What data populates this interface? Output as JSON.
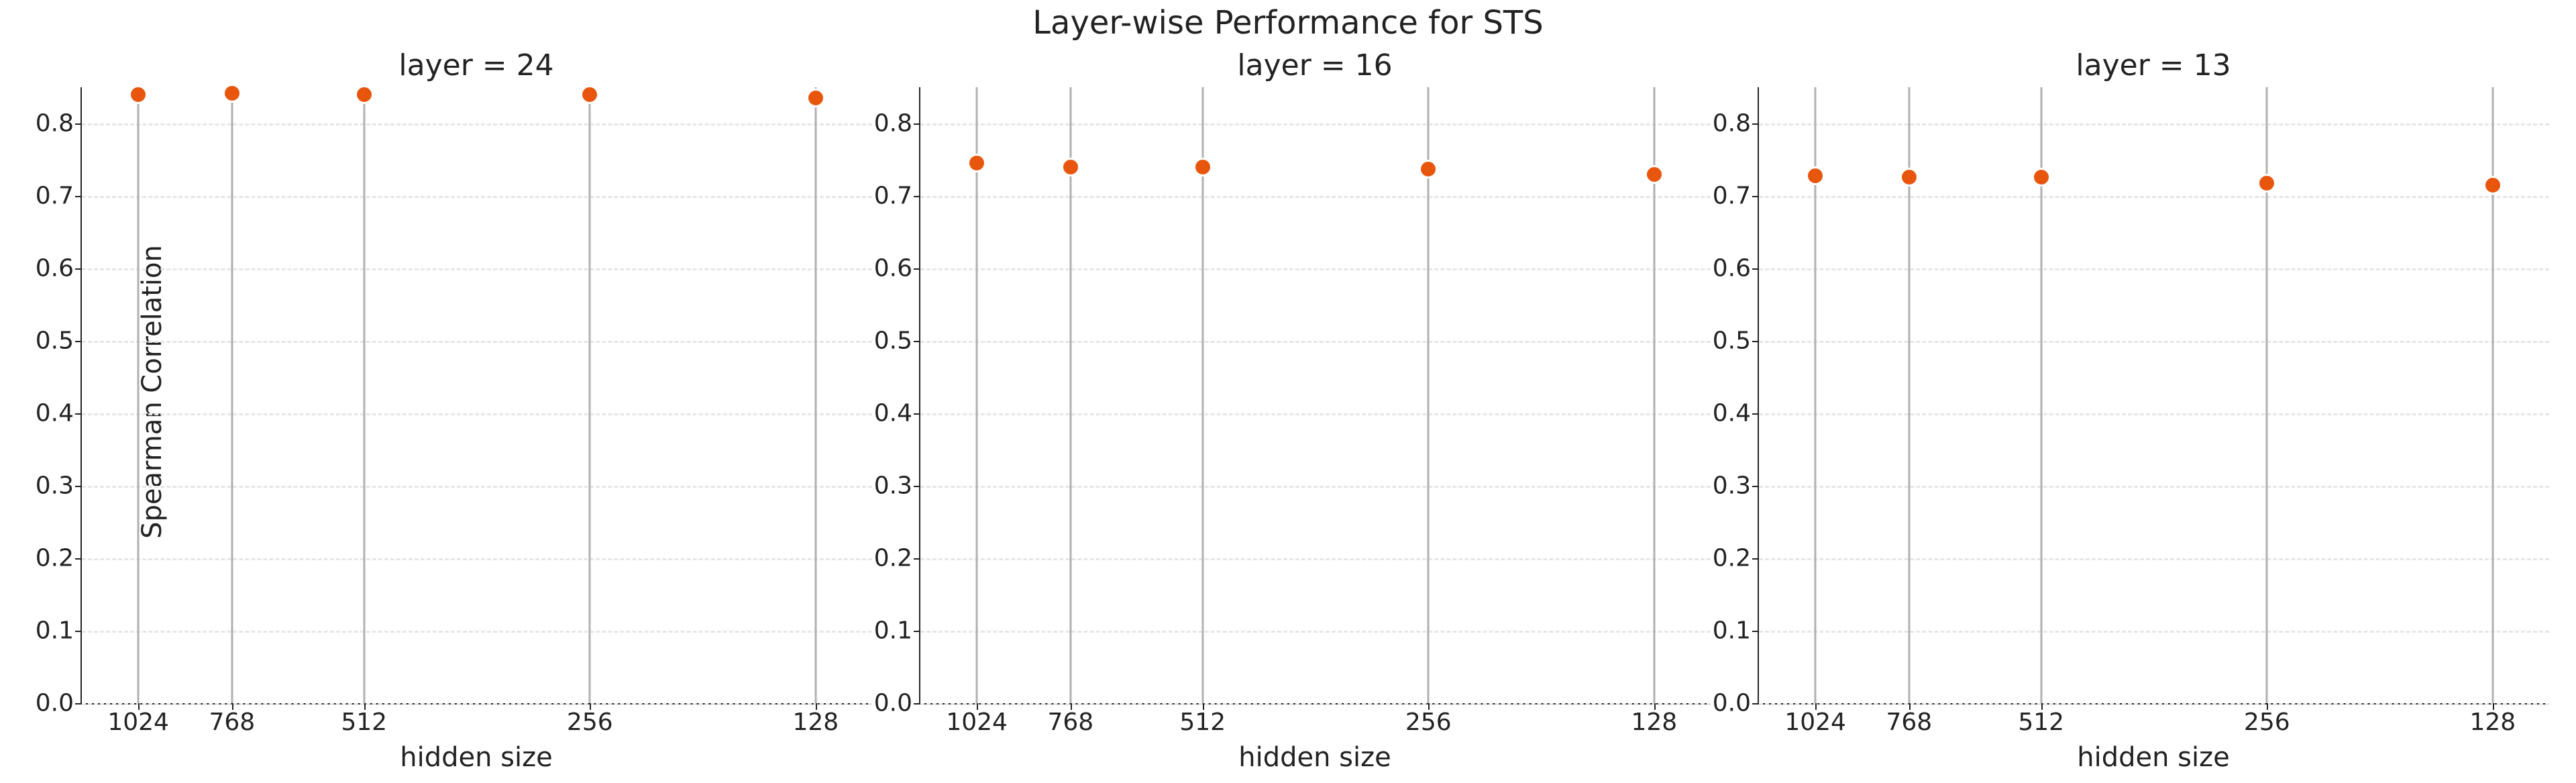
{
  "suptitle": "Layer-wise Performance for STS",
  "ylabel": "Spearman Correlation",
  "xlabel": "hidden size",
  "yticks": [
    0.0,
    0.1,
    0.2,
    0.3,
    0.4,
    0.5,
    0.6,
    0.7,
    0.8
  ],
  "ylim": [
    0.0,
    0.85
  ],
  "xcats": [
    "1024",
    "768",
    "512",
    "256",
    "128"
  ],
  "xpos_log": [
    10.0,
    9.585,
    9.0,
    8.0,
    7.0
  ],
  "xlim_log": [
    10.25,
    6.75
  ],
  "panels": [
    {
      "title": "layer = 24",
      "values": [
        0.84,
        0.842,
        0.84,
        0.84,
        0.835
      ],
      "err": [
        0.006,
        0.006,
        0.006,
        0.006,
        0.006
      ]
    },
    {
      "title": "layer = 16",
      "values": [
        0.745,
        0.74,
        0.74,
        0.737,
        0.73
      ],
      "err": [
        0.006,
        0.006,
        0.006,
        0.006,
        0.006
      ]
    },
    {
      "title": "layer = 13",
      "values": [
        0.728,
        0.726,
        0.726,
        0.718,
        0.715
      ],
      "err": [
        0.006,
        0.006,
        0.006,
        0.006,
        0.006
      ]
    }
  ],
  "chart_data": {
    "type": "scatter",
    "title": "Layer-wise Performance for STS",
    "xlabel": "hidden size",
    "ylabel": "Spearman Correlation",
    "ylim": [
      0.0,
      0.85
    ],
    "categories": [
      "1024",
      "768",
      "512",
      "256",
      "128"
    ],
    "facets": [
      {
        "name": "layer = 24",
        "series": [
          {
            "name": "spearman",
            "values": [
              0.84,
              0.842,
              0.84,
              0.84,
              0.835
            ]
          }
        ]
      },
      {
        "name": "layer = 16",
        "series": [
          {
            "name": "spearman",
            "values": [
              0.745,
              0.74,
              0.74,
              0.737,
              0.73
            ]
          }
        ]
      },
      {
        "name": "layer = 13",
        "series": [
          {
            "name": "spearman",
            "values": [
              0.728,
              0.726,
              0.726,
              0.718,
              0.715
            ]
          }
        ]
      }
    ],
    "grid": true
  }
}
